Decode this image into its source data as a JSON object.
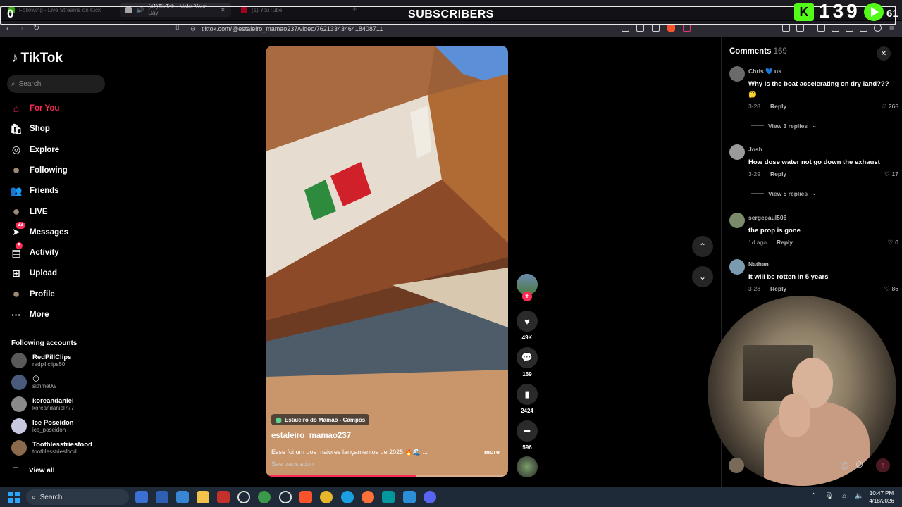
{
  "browser": {
    "tabs": [
      {
        "title": "Following - Live Streams on Kick",
        "active": false
      },
      {
        "title": "(41)TikTok - Make Your Day",
        "active": true
      },
      {
        "title": "(1) YouTube",
        "active": false
      }
    ],
    "url": "tiktok.com/@estaleiro_mamao237/video/7621334346418408711"
  },
  "stream_overlay": {
    "left_counter": "0",
    "title": "SUBSCRIBERS",
    "kick_count": "139",
    "youtube_count": "61"
  },
  "sidebar": {
    "logo": "TikTok",
    "search_placeholder": "Search",
    "nav": [
      {
        "label": "For You",
        "icon": "home-icon",
        "active": true,
        "badge": ""
      },
      {
        "label": "Shop",
        "icon": "shop-icon",
        "active": false,
        "badge": ""
      },
      {
        "label": "Explore",
        "icon": "compass-icon",
        "active": false,
        "badge": ""
      },
      {
        "label": "Following",
        "icon": "following-avatar-icon",
        "active": false,
        "badge": ""
      },
      {
        "label": "Friends",
        "icon": "friends-icon",
        "active": false,
        "badge": ""
      },
      {
        "label": "LIVE",
        "icon": "live-avatar-icon",
        "active": false,
        "badge": ""
      },
      {
        "label": "Messages",
        "icon": "messages-icon",
        "active": false,
        "badge": "33"
      },
      {
        "label": "Activity",
        "icon": "activity-icon",
        "active": false,
        "badge": "8"
      },
      {
        "label": "Upload",
        "icon": "upload-icon",
        "active": false,
        "badge": ""
      },
      {
        "label": "Profile",
        "icon": "profile-avatar-icon",
        "active": false,
        "badge": ""
      },
      {
        "label": "More",
        "icon": "more-icon",
        "active": false,
        "badge": ""
      }
    ],
    "following_header": "Following accounts",
    "accounts": [
      {
        "name": "RedPillClips",
        "handle": "redpillclips50"
      },
      {
        "name": "😶",
        "handle": "sithme0w"
      },
      {
        "name": "koreandaniel",
        "handle": "koreandaniel777"
      },
      {
        "name": "Ice Poseidon",
        "handle": "ice_poseidon"
      },
      {
        "name": "Toothlesstriesfood",
        "handle": "toothlesstriesfood"
      }
    ],
    "view_all": "View all"
  },
  "video": {
    "location": "Estaleiro do Mamão - Campos",
    "username": "estaleiro_mamao237",
    "caption": "Esse foi um dos maiores lançamentos de 2025 🔥🌊 ...",
    "more": "more",
    "see_translation": "See translation",
    "progress": 0.62,
    "likes": "49K",
    "comments": "169",
    "saves": "2424",
    "shares": "596"
  },
  "comments_panel": {
    "title": "Comments",
    "count": "169",
    "items": [
      {
        "user": "Chris 💙 us",
        "text": "Why is the boat accelerating on dry land??? 🤔",
        "date": "3-28",
        "reply": "Reply",
        "likes": "265",
        "view_replies": "View 3 replies"
      },
      {
        "user": "Josh",
        "text": "How dose water not go down the exhaust",
        "date": "3-29",
        "reply": "Reply",
        "likes": "17",
        "view_replies": "View 5 replies"
      },
      {
        "user": "sergepaul506",
        "text": "the prop is gone",
        "date": "1d ago",
        "reply": "Reply",
        "likes": "0",
        "view_replies": ""
      },
      {
        "user": "Nathan",
        "text": "It will be rotten in 5 years",
        "date": "3-28",
        "reply": "Reply",
        "likes": "86",
        "view_replies": ""
      }
    ]
  },
  "taskbar": {
    "search": "Search",
    "time": "10:47 PM",
    "date": "4/18/2026"
  },
  "colors": {
    "tiktok_red": "#fe2c55",
    "kick_green": "#53fc18",
    "taskbar": "#1f2a38"
  }
}
